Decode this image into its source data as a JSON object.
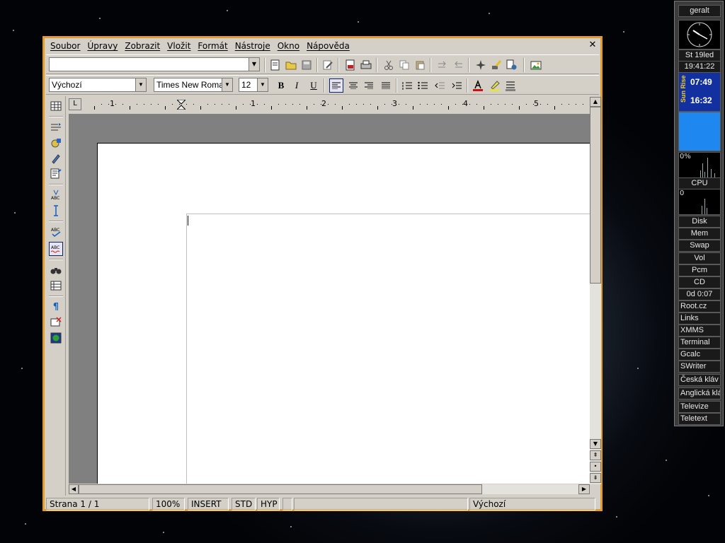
{
  "menubar": {
    "items": [
      "Soubor",
      "Úpravy",
      "Zobrazit",
      "Vložit",
      "Formát",
      "Nástroje",
      "Okno",
      "Nápověda"
    ]
  },
  "formatting": {
    "paragraph_style": "Výchozí",
    "font_name": "Times New Roma",
    "font_size": "12"
  },
  "ruler": {
    "labels": [
      "1",
      "1",
      "2",
      "3",
      "4",
      "5"
    ]
  },
  "statusbar": {
    "page": "Strana 1 / 1",
    "zoom": "100%",
    "insert_mode": "INSERT",
    "selection_mode": "STD",
    "hyphenation": "HYP",
    "page_style": "Výchozí"
  },
  "dock": {
    "user": "geralt",
    "date": "St 19led",
    "time": "19:41:22",
    "sunrise": "07:49",
    "sunset": "16:32",
    "sun_label": "Sun Rise",
    "cpu_percent": "0%",
    "cpu_label": "CPU",
    "disk_zero": "0",
    "disk_label": "Disk",
    "mem_label": "Mem",
    "swap_label": "Swap",
    "vol_label": "Vol",
    "pcm_label": "Pcm",
    "cd_label": "CD",
    "uptime": "0d 0:07",
    "launchers": [
      "Root.cz",
      "Links",
      "XMMS",
      "Terminal",
      "Gcalc",
      "SWriter",
      "Česká kláv",
      "Anglická kláv",
      "Televize",
      "Teletext"
    ]
  }
}
